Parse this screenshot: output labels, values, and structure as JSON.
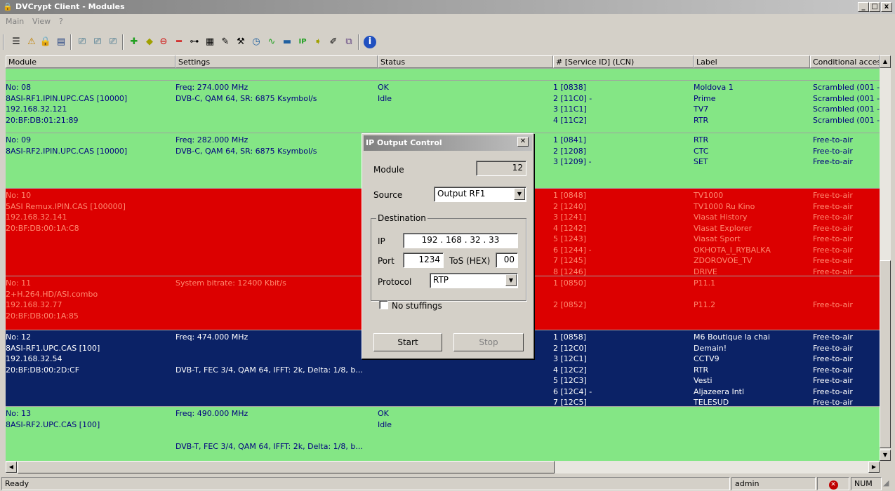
{
  "window": {
    "title": "DVCrypt Client - Modules",
    "min": "_",
    "max": "□",
    "close": "x"
  },
  "menu": [
    "Main",
    "View",
    "?"
  ],
  "columns": [
    "Module",
    "Settings",
    "Status",
    "# [Service ID] (LCN)",
    "Label",
    "Conditional acces"
  ],
  "rows": [
    {
      "color": "green",
      "module": [
        "No: 08",
        "8ASI-RF1.IPIN.UPC.CAS [10000]",
        "192.168.32.121",
        "20:BF:DB:01:21:89"
      ],
      "settings": [
        "Freq: 274.000 MHz",
        "DVB-C, QAM 64, SR: 6875 Ksymbol/s"
      ],
      "status": [
        "OK",
        "Idle"
      ],
      "services": [
        "1 [0838]",
        "2 [11C0] -",
        "3 [11C1]",
        "4 [11C2]"
      ],
      "labels": [
        "Moldova 1",
        "Prime",
        "TV7",
        "RTR"
      ],
      "ca": [
        "Scrambled (001 -",
        "Scrambled (001 -",
        "Scrambled (001 -",
        "Scrambled (001 -"
      ]
    },
    {
      "color": "green",
      "module": [
        "No: 09",
        "8ASI-RF2.IPIN.UPC.CAS [10000]"
      ],
      "settings": [
        "Freq: 282.000 MHz",
        "DVB-C, QAM 64, SR: 6875 Ksymbol/s"
      ],
      "status": [],
      "services": [
        "1 [0841]",
        "2 [1208]",
        "3 [1209] -"
      ],
      "labels": [
        "RTR",
        "CTC",
        "SET"
      ],
      "ca": [
        "Free-to-air",
        "Free-to-air",
        "Free-to-air"
      ]
    },
    {
      "color": "red",
      "module": [
        "No: 10",
        "5ASI Remux.IPIN.CAS [100000]",
        "192.168.32.141",
        "20:BF:DB:00:1A:C8"
      ],
      "settings": [],
      "status": [],
      "services": [
        "1 [0848]",
        "2 [1240]",
        "3 [1241]",
        "4 [1242]",
        "5 [1243]",
        "6 [1244] -",
        "7 [1245]",
        "8 [1246]"
      ],
      "labels": [
        "TV1000",
        "TV1000 Ru Kino",
        "Viasat History",
        "Viasat Explorer",
        "Viasat Sport",
        "OKHOTA_I_RYBALKA",
        "ZDOROVOE_TV",
        "DRIVE"
      ],
      "ca": [
        "Free-to-air",
        "Free-to-air",
        "Free-to-air",
        "Free-to-air",
        "Free-to-air",
        "Free-to-air",
        "Free-to-air",
        "Free-to-air"
      ]
    },
    {
      "color": "red",
      "module": [
        "No: 11",
        "2+H.264.HD/ASI.combo",
        "192.168.32.77",
        "20:BF:DB:00:1A:85"
      ],
      "settings": [
        "System bitrate: 12400 Kbit/s"
      ],
      "status": [],
      "services": [
        "1 [0850]",
        "",
        "2 [0852]"
      ],
      "labels": [
        "P11.1",
        "",
        "P11.2"
      ],
      "ca": [
        "",
        "",
        "Free-to-air"
      ]
    },
    {
      "color": "navy",
      "module": [
        "No: 12",
        "8ASI-RF1.UPC.CAS [100]",
        "192.168.32.54",
        "20:BF:DB:00:2D:CF"
      ],
      "settings": [
        "Freq: 474.000 MHz",
        "",
        "",
        "DVB-T, FEC 3/4, QAM 64, IFFT: 2k, Delta: 1/8, b..."
      ],
      "status": [],
      "services": [
        "1 [0858]",
        "2 [12C0]",
        "3 [12C1]",
        "4 [12C2]",
        "5 [12C3]",
        "6 [12C4] -",
        "7 [12C5]"
      ],
      "labels": [
        "M6 Boutique la chai",
        "Demain!",
        "CCTV9",
        "RTR",
        "Vesti",
        "Aljazeera Intl",
        "TELESUD"
      ],
      "ca": [
        "Free-to-air",
        "Free-to-air",
        "Free-to-air",
        "Free-to-air",
        "Free-to-air",
        "Free-to-air",
        "Free-to-air"
      ]
    },
    {
      "color": "green",
      "module": [
        "No: 13",
        "8ASI-RF2.UPC.CAS [100]"
      ],
      "settings": [
        "Freq: 490.000 MHz",
        "",
        "",
        "DVB-T, FEC 3/4, QAM 64, IFFT: 2k, Delta: 1/8, b..."
      ],
      "status": [
        "OK",
        "Idle"
      ],
      "services": [],
      "labels": [],
      "ca": []
    }
  ],
  "dialog": {
    "title": "IP Output Control",
    "module_label": "Module",
    "module_value": "12",
    "source_label": "Source",
    "source_value": "Output RF1",
    "destination_label": "Destination",
    "ip_label": "IP",
    "ip": [
      "192",
      "168",
      "32",
      "33"
    ],
    "port_label": "Port",
    "port_value": "1234",
    "tos_label": "ToS (HEX)",
    "tos_value": "00",
    "protocol_label": "Protocol",
    "protocol_value": "RTP",
    "no_stuffings_label": "No stuffings",
    "start_label": "Start",
    "stop_label": "Stop"
  },
  "statusbar": {
    "ready": "Ready",
    "user": "admin",
    "num": "NUM"
  },
  "colors": {
    "green": "#84e685",
    "red": "#dc0000",
    "navy": "#0b2266"
  }
}
